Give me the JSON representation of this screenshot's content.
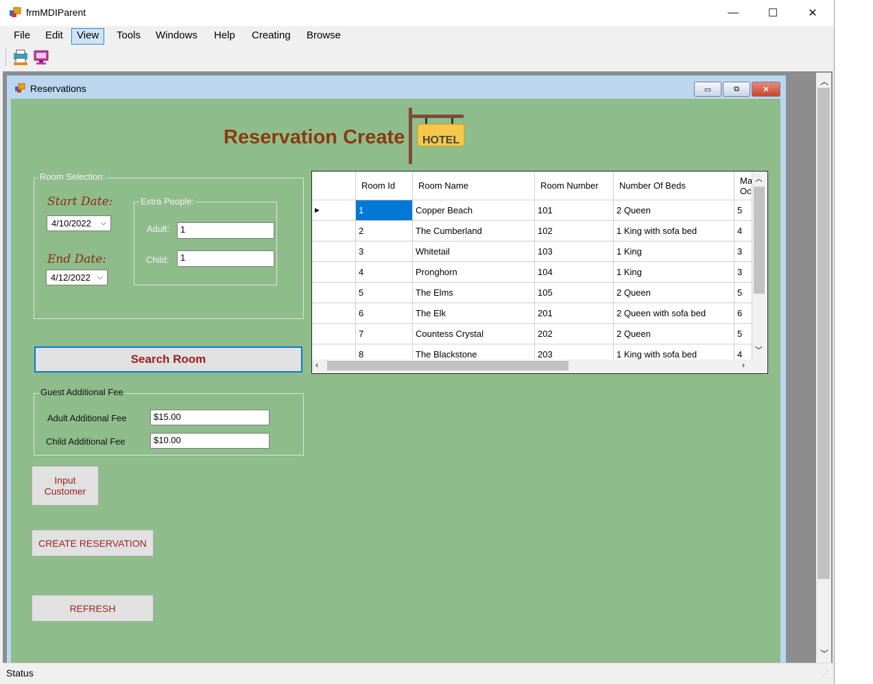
{
  "window": {
    "title": "frmMDIParent",
    "minimize": "—",
    "maximize": "☐",
    "close": "✕"
  },
  "menu": [
    "File",
    "Edit",
    "View",
    "Tools",
    "Windows",
    "Help",
    "Creating",
    "Browse"
  ],
  "menu_active": "View",
  "child": {
    "title": "Reservations"
  },
  "form": {
    "heading": "Reservation Create",
    "hotel_sign": "HOTEL",
    "room_selection_legend": "Room Selection:",
    "start_date_label": "Start Date:",
    "start_date_value": "4/10/2022",
    "end_date_label": "End Date:",
    "end_date_value": "4/12/2022",
    "extra_people_legend": "Extra People:",
    "adult_label": "Adult:",
    "adult_value": "1",
    "child_label": "Child:",
    "child_value": "1",
    "search_button": "Search Room",
    "fee_legend": "Guest Additional Fee",
    "adult_fee_label": "Adult Additional Fee",
    "adult_fee_value": "$15.00",
    "child_fee_label": "Child Additional Fee",
    "child_fee_value": "$10.00",
    "input_customer_button": "Input Customer",
    "create_button": "CREATE RESERVATION",
    "refresh_button": "REFRESH"
  },
  "grid": {
    "columns": [
      "Room Id",
      "Room Name",
      "Room Number",
      "Number Of Beds",
      "Ma Oc"
    ],
    "rows": [
      [
        "1",
        "Copper Beach",
        "101",
        "2 Queen",
        "5"
      ],
      [
        "2",
        "The Cumberland",
        "102",
        "1 King with sofa bed",
        "4"
      ],
      [
        "3",
        "Whitetail",
        "103",
        "1 King",
        "3"
      ],
      [
        "4",
        "Pronghorn",
        "104",
        "1 King",
        "3"
      ],
      [
        "5",
        "The Elms",
        "105",
        "2 Queen",
        "5"
      ],
      [
        "6",
        "The Elk",
        "201",
        "2 Queen with sofa bed",
        "6"
      ],
      [
        "7",
        "Countess Crystal",
        "202",
        "2 Queen",
        "5"
      ],
      [
        "8",
        "The Blackstone",
        "203",
        "1 King with sofa bed",
        "4"
      ]
    ],
    "selected_row": 0
  },
  "status": {
    "text": "Status"
  },
  "colors": {
    "form_bg": "#8fbc8b",
    "accent_text": "#8b2a1c",
    "selection": "#0078d7"
  }
}
